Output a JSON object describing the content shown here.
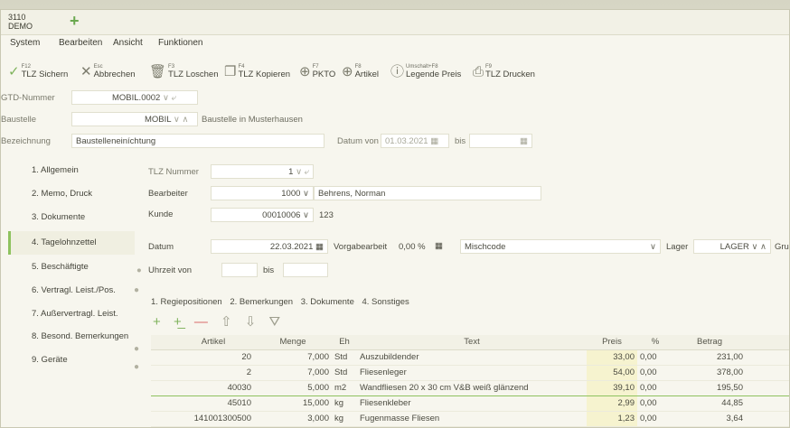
{
  "window": {
    "tab_label_top": "3110",
    "tab_label_bottom": "DEMO",
    "add_tab": "+"
  },
  "menu": [
    "System",
    "Bearbeiten",
    "Ansicht",
    "Funktionen"
  ],
  "toolbar": [
    {
      "key": "F12",
      "label": "TLZ Sichern",
      "icon": "check-icon"
    },
    {
      "key": "Esc",
      "label": "Abbrechen",
      "icon": "close-icon"
    },
    {
      "key": "F3",
      "label": "TLZ Loschen",
      "icon": "trash-icon"
    },
    {
      "key": "F4",
      "label": "TLZ Kopieren",
      "icon": "copy-icon"
    },
    {
      "key": "F7",
      "label": "PKTO",
      "icon": "plus-circle-icon"
    },
    {
      "key": "F8",
      "label": "Artikel",
      "icon": "plus-circle-icon"
    },
    {
      "key": "Umschalt+F8",
      "label": "Legende Preis",
      "icon": "info-icon"
    },
    {
      "key": "F9",
      "label": "TLZ Drucken",
      "icon": "print-icon"
    }
  ],
  "header": {
    "gtd_label": "GTD-Nummer",
    "gtd_value": "MOBIL.0002",
    "baustelle_label": "Baustelle",
    "baustelle_value": "MOBIL",
    "baustelle_desc": "Baustelle in Musterhausen",
    "bezeichnung_label": "Bezeichnung",
    "bezeichnung_value": "Baustelleneiníchtung",
    "datum_von_label": "Datum von",
    "datum_von_value": "01.03.2021",
    "bis_label": "bis"
  },
  "nav": [
    {
      "label": "1. Allgemein",
      "active": false
    },
    {
      "label": "2. Memo, Druck",
      "active": false
    },
    {
      "label": "3. Dokumente",
      "active": false
    },
    {
      "label": "4. Tagelohnzettel",
      "active": true
    },
    {
      "label": "5. Beschäftigte",
      "active": false
    },
    {
      "label": "6. Vertragl. Leist./Pos.",
      "active": false
    },
    {
      "label": "7. Außervertragl. Leist.",
      "active": false
    },
    {
      "label": "8. Besond. Bemerkungen",
      "active": false
    },
    {
      "label": "9. Geräte",
      "active": false
    }
  ],
  "form": {
    "tlz_label": "TLZ Nummer",
    "tlz_value": "1",
    "bearbeiter_label": "Bearbeiter",
    "bearbeiter_value": "1000",
    "bearbeiter_name": "Behrens, Norman",
    "kunde_label": "Kunde",
    "kunde_value": "00010006",
    "kunde_num": "123",
    "datum_label": "Datum",
    "datum_value": "22.03.2021",
    "vorgabe_label": "Vorgabearbeit",
    "vorgabe_value": "0,00 %",
    "mischcode_label": "Mischcode",
    "lager_label": "Lager",
    "lager_value": "LAGER",
    "grup_label": "Gru",
    "uhrzeit_label": "Uhrzeit von",
    "bis_label": "bis"
  },
  "subtabs": [
    "1. Regiepositionen",
    "2. Bemerkungen",
    "3. Dokumente",
    "4. Sonstiges"
  ],
  "table": {
    "columns": [
      "Artikel",
      "Menge",
      "Eh",
      "Text",
      "Preis",
      "%",
      "Betrag"
    ],
    "rows": [
      [
        "20",
        "7,000",
        "Std",
        "Auszubildender",
        "33,00",
        "0,00",
        "231,00"
      ],
      [
        "2",
        "7,000",
        "Std",
        "Fliesenleger",
        "54,00",
        "0,00",
        "378,00"
      ],
      [
        "40030",
        "5,000",
        "m2",
        "Wandfliesen 20 x 30 cm V&B weiß glänzend",
        "39,10",
        "0,00",
        "195,50"
      ],
      [
        "45010",
        "15,000",
        "kg",
        "Fliesenkleber",
        "2,99",
        "0,00",
        "44,85"
      ],
      [
        "141001300500",
        "3,000",
        "kg",
        "Fugenmasse Fliesen",
        "1,23",
        "0,00",
        "3,64"
      ]
    ],
    "selected_row": 2
  }
}
